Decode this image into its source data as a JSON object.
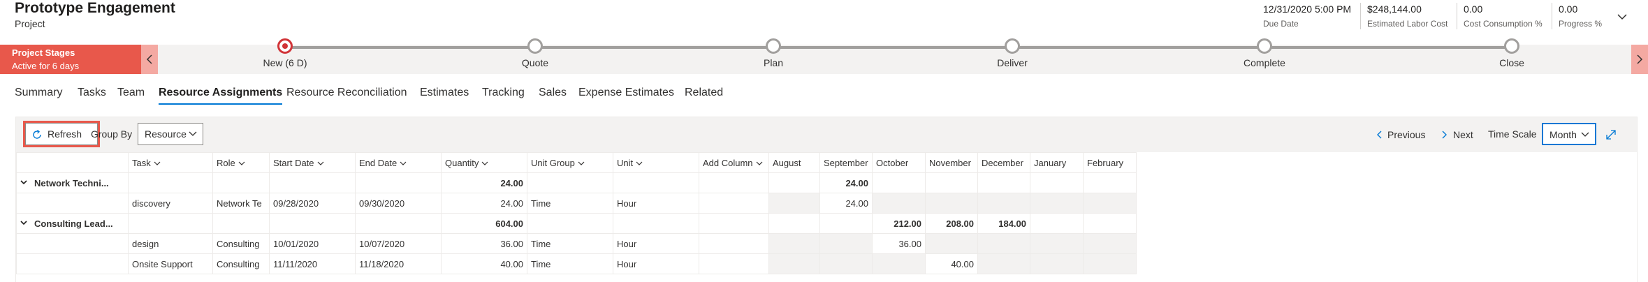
{
  "header": {
    "title": "Prototype Engagement",
    "subtitle": "Project",
    "kpis": [
      {
        "value": "12/31/2020 5:00 PM",
        "label": "Due Date"
      },
      {
        "value": "$248,144.00",
        "label": "Estimated Labor Cost"
      },
      {
        "value": "0.00",
        "label": "Cost Consumption %"
      },
      {
        "value": "0.00",
        "label": "Progress %"
      }
    ]
  },
  "bpf": {
    "stage_title": "Project Stages",
    "stage_status": "Active for 6 days",
    "stages": [
      {
        "label": "New  (6 D)",
        "active": true
      },
      {
        "label": "Quote",
        "active": false
      },
      {
        "label": "Plan",
        "active": false
      },
      {
        "label": "Deliver",
        "active": false
      },
      {
        "label": "Complete",
        "active": false
      },
      {
        "label": "Close",
        "active": false
      }
    ]
  },
  "tabs": [
    "Summary",
    "Tasks",
    "Team",
    "Resource Assignments",
    "Resource Reconciliation",
    "Estimates",
    "Tracking",
    "Sales",
    "Expense Estimates",
    "Related"
  ],
  "selected_tab": "Resource Assignments",
  "toolbar": {
    "refresh_label": "Refresh",
    "group_by_label": "Group By",
    "group_by_value": "Resource",
    "previous_label": "Previous",
    "next_label": "Next",
    "time_scale_label": "Time Scale",
    "time_scale_value": "Month"
  },
  "columns": [
    "",
    "Task",
    "Role",
    "Start Date",
    "End Date",
    "Quantity",
    "Unit Group",
    "Unit",
    "Add Column",
    "August",
    "September",
    "October",
    "November",
    "December",
    "January",
    "February"
  ],
  "rows": [
    {
      "type": "group",
      "cells": [
        "Network Techni...",
        "",
        "",
        "",
        "",
        "24.00",
        "",
        "",
        "",
        "",
        "24.00",
        "",
        "",
        "",
        "",
        ""
      ]
    },
    {
      "type": "item",
      "cells": [
        "",
        "discovery",
        "Network Te",
        "09/28/2020",
        "09/30/2020",
        "24.00",
        "Time",
        "Hour",
        "",
        "",
        "24.00",
        "",
        "",
        "",
        "",
        ""
      ]
    },
    {
      "type": "group",
      "cells": [
        "Consulting Lead...",
        "",
        "",
        "",
        "",
        "604.00",
        "",
        "",
        "",
        "",
        "",
        "212.00",
        "208.00",
        "184.00",
        "",
        ""
      ]
    },
    {
      "type": "item",
      "cells": [
        "",
        "design",
        "Consulting",
        "10/01/2020",
        "10/07/2020",
        "36.00",
        "Time",
        "Hour",
        "",
        "",
        "",
        "36.00",
        "",
        "",
        "",
        ""
      ]
    },
    {
      "type": "item",
      "cells": [
        "",
        "Onsite Support",
        "Consulting",
        "11/11/2020",
        "11/18/2020",
        "40.00",
        "Time",
        "Hour",
        "",
        "",
        "",
        "",
        "40.00",
        "",
        "",
        ""
      ]
    }
  ],
  "colors": {
    "accent": "#0078d4",
    "stage_red": "#e8584b",
    "active_dot": "#d13438"
  }
}
